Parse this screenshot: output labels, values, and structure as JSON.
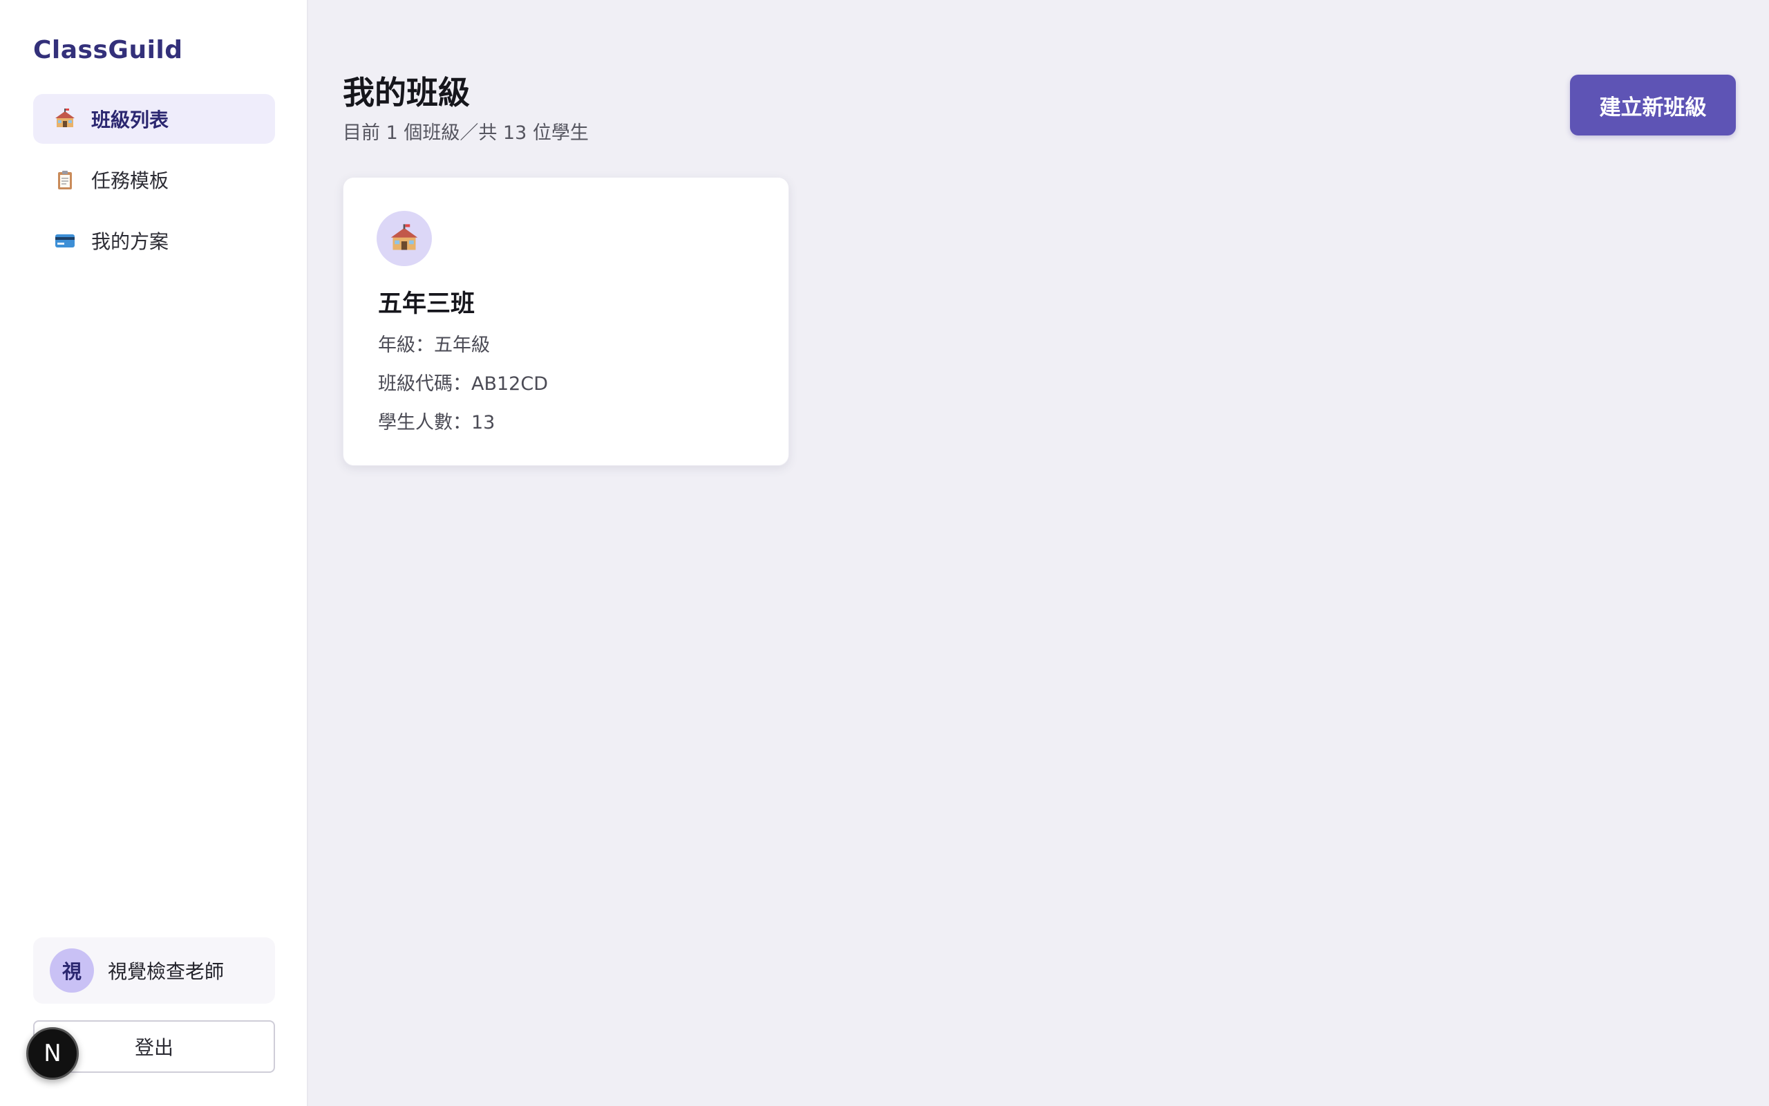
{
  "brand": "ClassGuild",
  "sidebar": {
    "items": [
      {
        "label": "班級列表",
        "icon": "school-icon",
        "active": true
      },
      {
        "label": "任務模板",
        "icon": "clipboard-icon",
        "active": false
      },
      {
        "label": "我的方案",
        "icon": "credit-card-icon",
        "active": false
      }
    ],
    "user": {
      "avatar_initial": "視",
      "name": "視覺檢查老師"
    },
    "logout_label": "登出",
    "dev_badge": "N"
  },
  "main": {
    "title": "我的班級",
    "subtitle": "目前 1 個班級／共 13 位學生",
    "create_button": "建立新班級",
    "classes": [
      {
        "name": "五年三班",
        "grade_line": "年級：五年級",
        "code_line": "班級代碼：AB12CD",
        "students_line": "學生人數：13"
      }
    ]
  },
  "colors": {
    "accent": "#5e54b5",
    "brand_text": "#33307a",
    "active_nav_bg": "#efedfb",
    "avatar_bg": "#c9c1f5",
    "background": "#f0eff5"
  }
}
